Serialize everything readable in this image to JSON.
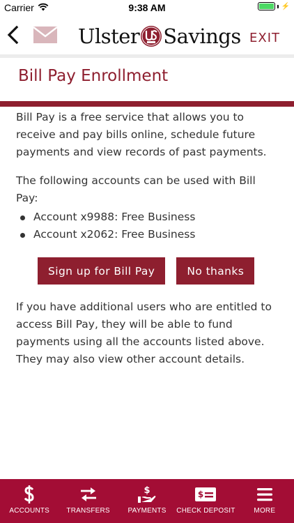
{
  "status_bar": {
    "carrier": "Carrier",
    "time": "9:38 AM",
    "battery_level": 1.0
  },
  "header": {
    "logo_left": "Ulster",
    "logo_right": "Savings",
    "exit_label": "EXIT"
  },
  "page": {
    "title": "Bill Pay Enrollment",
    "intro": "Bill Pay is a free service that allows you to receive and pay bills online, schedule future payments and view records of past payments.",
    "accounts_lead": "The following accounts can be used with Bill Pay:",
    "accounts": [
      "Account x9988: Free Business",
      "Account x2062: Free Business"
    ],
    "signup_label": "Sign up for Bill Pay",
    "decline_label": "No thanks",
    "footer_note": "If you have additional users who are entitled to access Bill Pay, they will be able to fund payments using all the accounts listed above. They may also view other account details."
  },
  "nav": {
    "items": [
      {
        "label": "ACCOUNTS",
        "icon": "dollar-icon"
      },
      {
        "label": "TRANSFERS",
        "icon": "transfer-arrows-icon"
      },
      {
        "label": "PAYMENTS",
        "icon": "hand-dollar-icon"
      },
      {
        "label": "CHECK DEPOSIT",
        "icon": "check-icon"
      },
      {
        "label": "MORE",
        "icon": "hamburger-menu-icon"
      }
    ]
  },
  "colors": {
    "brand": "#8e1f2f",
    "nav_background": "#a30d35",
    "battery": "#4cd964"
  }
}
